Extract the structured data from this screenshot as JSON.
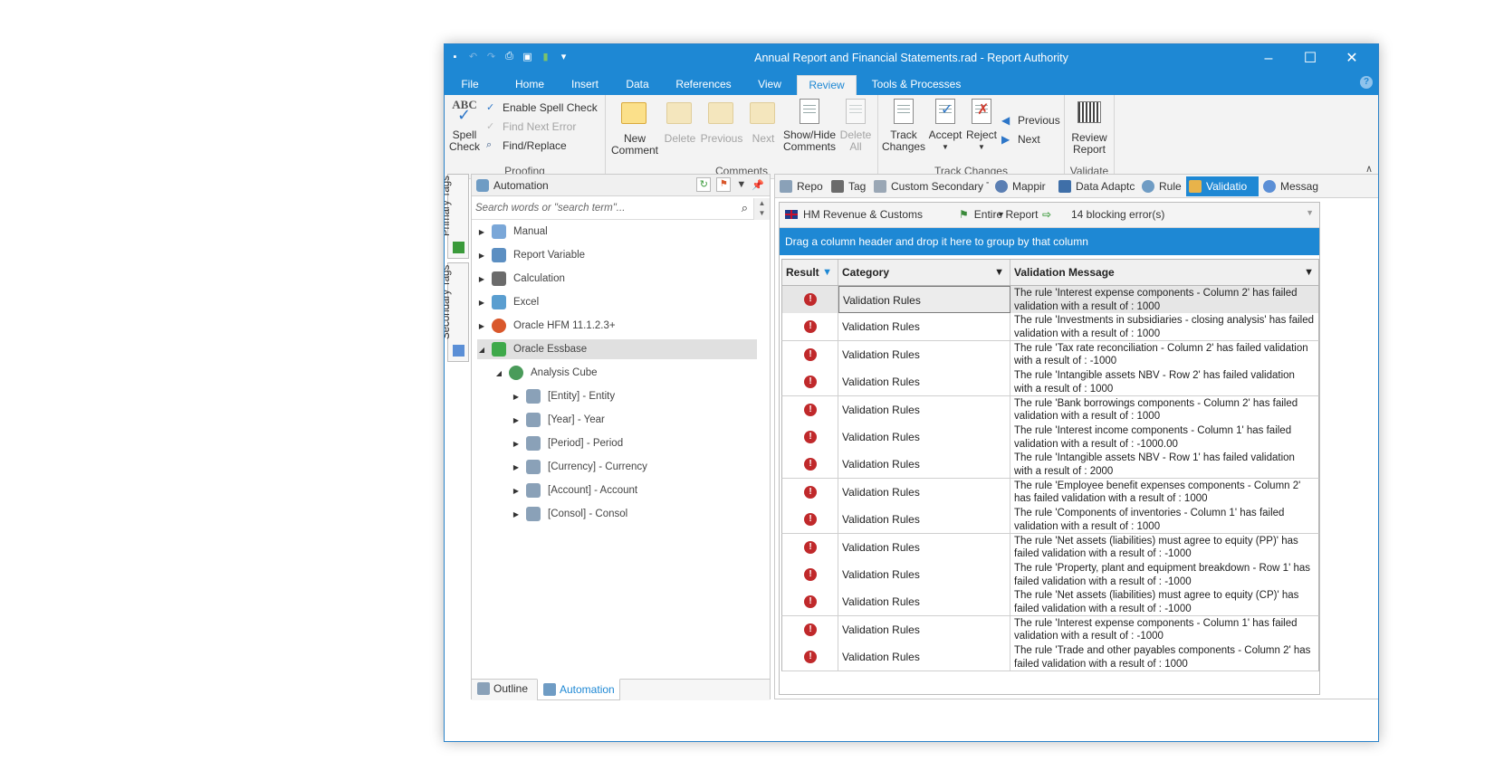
{
  "window": {
    "title": "Annual Report and Financial Statements.rad - Report Authority",
    "controls": [
      "–",
      "☐",
      "✕"
    ]
  },
  "ribbon_tabs": [
    "File",
    "Home",
    "Insert",
    "Data",
    "References",
    "View",
    "Review",
    "Tools & Processes"
  ],
  "active_tab": "Review",
  "ribbon": {
    "proofing": {
      "label": "Proofing",
      "spell_check": "Spell\nCheck",
      "enable_spell_check": "Enable Spell Check",
      "find_next_error": "Find Next Error",
      "find_replace": "Find/Replace"
    },
    "comments": {
      "label": "Comments",
      "new_comment": "New\nComment",
      "delete": "Delete",
      "previous": "Previous",
      "next": "Next",
      "show_hide": "Show/Hide\nComments",
      "delete_all": "Delete\nAll"
    },
    "track_changes": {
      "label": "Track Changes",
      "track": "Track\nChanges",
      "accept": "Accept",
      "reject": "Reject",
      "previous": "Previous",
      "next": "Next"
    },
    "validate": {
      "label": "Validate",
      "review_report": "Review\nReport"
    }
  },
  "side_tabs": [
    "Primary Tags",
    "Secondary Tags"
  ],
  "automation": {
    "title": "Automation",
    "search_placeholder": "Search words or \"search term\"...",
    "nodes": [
      {
        "label": "Manual",
        "color": "#7aa7d8"
      },
      {
        "label": "Report Variable",
        "color": "#5c8fc2"
      },
      {
        "label": "Calculation",
        "color": "#6b6b6b"
      },
      {
        "label": "Excel",
        "color": "#5a9ed0"
      },
      {
        "label": "Oracle HFM 11.1.2.3+",
        "color": "#d9572b"
      },
      {
        "label": "Oracle Essbase",
        "color": "#3ea94a"
      },
      {
        "label": "Analysis Cube",
        "color": "#4a9b5a"
      },
      {
        "label": "[Entity] - Entity",
        "color": "#8aa1b8"
      },
      {
        "label": "[Year] - Year",
        "color": "#8aa1b8"
      },
      {
        "label": "[Period] - Period",
        "color": "#8aa1b8"
      },
      {
        "label": "[Currency] - Currency",
        "color": "#8aa1b8"
      },
      {
        "label": "[Account] - Account",
        "color": "#8aa1b8"
      },
      {
        "label": "[Consol] - Consol",
        "color": "#8aa1b8"
      }
    ],
    "bottom_tabs": [
      "Outline",
      "Automation"
    ]
  },
  "doc_tabs": [
    "Repo",
    "Tag",
    "Custom Secondary T",
    "Mappir",
    "Data Adaptc",
    "Rule",
    "Validatio",
    "Messag"
  ],
  "active_doc_tab": "Validatio",
  "validation": {
    "authority": "HM Revenue & Customs",
    "scope": "Entire Report",
    "status": "14 blocking error(s)",
    "group_hint": "Drag a column header and drop it here to group by that column",
    "columns": [
      "Result",
      "Category",
      "Validation Message"
    ],
    "rows": [
      {
        "category": "Validation Rules",
        "message": "The rule 'Interest expense components - Column 2' has failed validation with a result of : 1000"
      },
      {
        "category": "Validation Rules",
        "message": "The rule 'Investments in subsidiaries - closing analysis' has failed validation with a result of : 1000"
      },
      {
        "category": "Validation Rules",
        "message": "The rule 'Tax rate reconciliation - Column 2' has failed validation with a result of : -1000"
      },
      {
        "category": "Validation Rules",
        "message": "The rule 'Intangible assets NBV - Row 2' has failed validation with a result of : 1000"
      },
      {
        "category": "Validation Rules",
        "message": "The rule 'Bank borrowings components - Column 2' has failed validation with a result of : 1000"
      },
      {
        "category": "Validation Rules",
        "message": "The rule 'Interest income components - Column 1' has failed validation with a result of : -1000.00"
      },
      {
        "category": "Validation Rules",
        "message": "The rule 'Intangible assets NBV - Row 1' has failed validation with a result of : 2000"
      },
      {
        "category": "Validation Rules",
        "message": "The rule 'Employee benefit expenses components - Column 2' has failed validation with a result of : 1000"
      },
      {
        "category": "Validation Rules",
        "message": "The rule 'Components of inventories - Column 1' has failed validation with a result of : 1000"
      },
      {
        "category": "Validation Rules",
        "message": "The rule 'Net assets (liabilities) must agree to equity (PP)' has failed validation with a result of : -1000"
      },
      {
        "category": "Validation Rules",
        "message": "The rule 'Property, plant and equipment breakdown - Row 1' has failed validation with a result of : -1000"
      },
      {
        "category": "Validation Rules",
        "message": "The rule 'Net assets (liabilities) must agree to equity (CP)' has failed validation with a result of : -1000"
      },
      {
        "category": "Validation Rules",
        "message": "The rule 'Interest expense components - Column 1' has failed validation with a result of : -1000"
      },
      {
        "category": "Validation Rules",
        "message": "The rule 'Trade and other payables components - Column 2' has failed validation with a result of : 1000"
      }
    ]
  },
  "colors": {
    "accent": "#1e88d4",
    "error": "#c0292b"
  }
}
